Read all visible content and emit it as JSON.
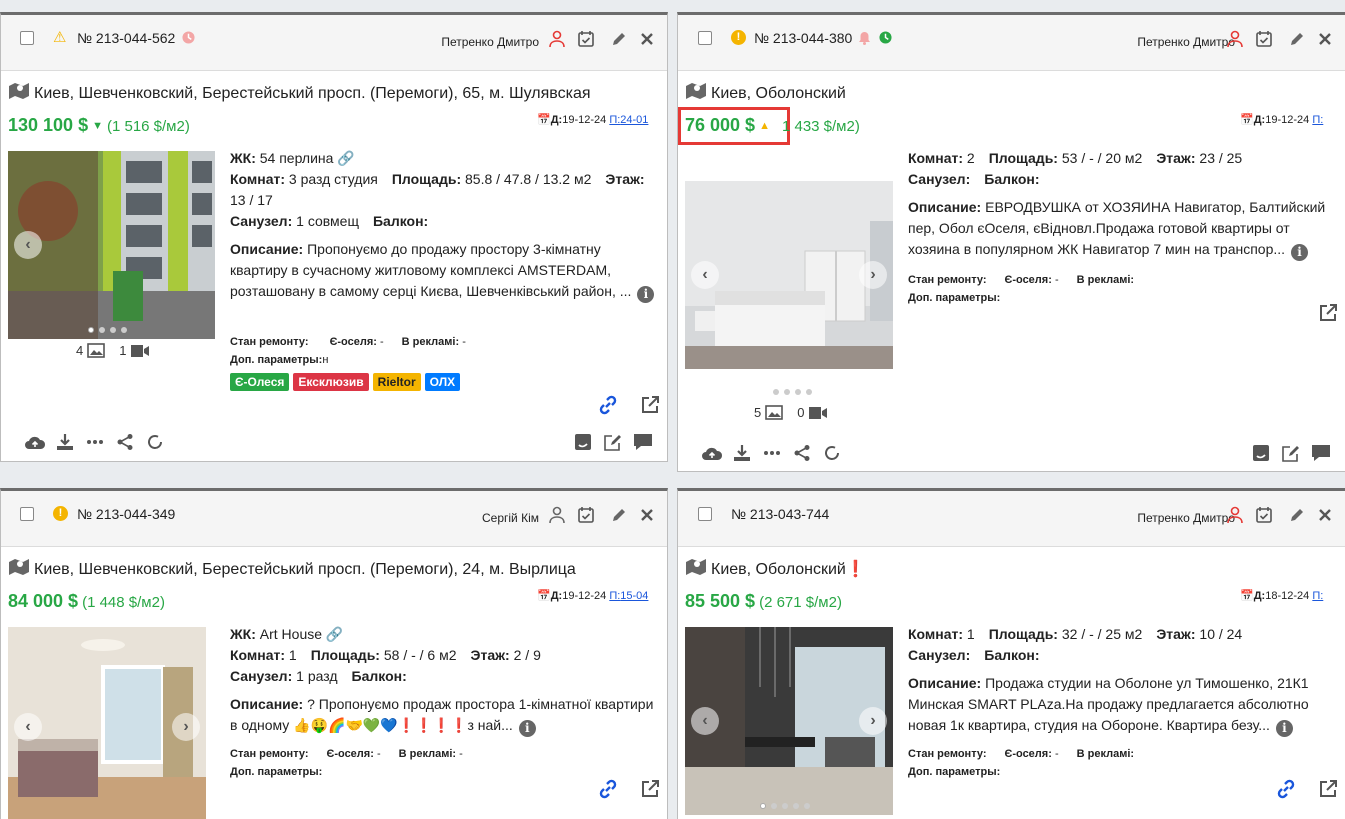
{
  "cards": [
    {
      "id": "№ 213-044-562",
      "agent": "Петренко Дмитро",
      "address": "Киев, Шевченковский, Берестейський просп. (Перемоги), 65, м. Шулявская",
      "price": "130 100 $",
      "price_per_sqm": "(1 516 $/м2)",
      "date_label": "Д:",
      "date": "19-12-24",
      "p_label": "П:",
      "p_value": "24-01",
      "zhk_label": "ЖК:",
      "zhk": "54 перлина",
      "rooms_label": "Комнат:",
      "rooms": "3 разд студия",
      "area_label": "Площадь:",
      "area": "85.8 / 47.8 / 13.2 м2",
      "floor_label": "Этаж:",
      "floor": "13 / 17",
      "bath_label": "Санузел:",
      "bath": "1 совмещ",
      "balcony_label": "Балкон:",
      "balcony": "",
      "desc_label": "Описание:",
      "desc": "Пропонуємо до продажу простору 3-кімнатну квартиру в сучасному житловому комплексі AMSTERDAM, розташовану в самому серці Києва, Шевченківський район, ...",
      "repair_label": "Стан ремонту:",
      "repair": "",
      "eoselya_label": "Є-оселя:",
      "eoselya": "-",
      "ads_label": "В рекламі:",
      "ads": "-",
      "extra_label": "Доп. параметры:",
      "extra": "н",
      "photos": "4",
      "videos": "1",
      "tags": [
        "Є-Олеся",
        "Ексклюзив",
        "Rieltor",
        "ОЛХ"
      ]
    },
    {
      "id": "№ 213-044-380",
      "agent": "Петренко Дмитро",
      "address": "Киев, Оболонский",
      "price": "76 000 $",
      "price_per_sqm": "1 433 $/м2)",
      "date_label": "Д:",
      "date": "19-12-24",
      "p_label": "П:",
      "rooms_label": "Комнат:",
      "rooms": "2",
      "area_label": "Площадь:",
      "area": "53 / - / 20 м2",
      "floor_label": "Этаж:",
      "floor": "23 / 25",
      "bath_label": "Санузел:",
      "balcony_label": "Балкон:",
      "desc_label": "Описание:",
      "desc": "ЕВРОДВУШКА от ХОЗЯИНА Навигатор, Балтийский пер, Обол єОселя, єВідновл.Продажа готовой квартиры от хозяина в популярном ЖК Навигатор 7 мин на транспор...",
      "repair_label": "Стан ремонту:",
      "eoselya_label": "Є-оселя:",
      "eoselya": "-",
      "ads_label": "В рекламі:",
      "extra_label": "Доп. параметры:",
      "photos": "5",
      "videos": "0"
    },
    {
      "id": "№ 213-044-349",
      "agent": "Сергій Кім",
      "address": "Киев, Шевченковский, Берестейський просп. (Перемоги), 24, м. Вырлица",
      "price": "84 000 $",
      "price_per_sqm": "(1 448 $/м2)",
      "date_label": "Д:",
      "date": "19-12-24",
      "p_label": "П:",
      "p_value": "15-04",
      "zhk_label": "ЖК:",
      "zhk": "Art House",
      "rooms_label": "Комнат:",
      "rooms": "1",
      "area_label": "Площадь:",
      "area": "58 / - / 6 м2",
      "floor_label": "Этаж:",
      "floor": "2 / 9",
      "bath_label": "Санузел:",
      "bath": "1 разд",
      "balcony_label": "Балкон:",
      "desc_label": "Описание:",
      "desc": "? Пропонуємо продаж простора 1-кімнатної квартири в одному 👍🤑🌈🤝💚💙❗❗❗❗з най...",
      "repair_label": "Стан ремонту:",
      "eoselya_label": "Є-оселя:",
      "eoselya": "-",
      "ads_label": "В рекламі:",
      "ads": "-",
      "extra_label": "Доп. параметры:"
    },
    {
      "id": "№ 213-043-744",
      "agent": "Петренко Дмитро",
      "address": "Киев, Оболонский",
      "address_mark": "❗",
      "price": "85 500 $",
      "price_per_sqm": "(2 671 $/м2)",
      "date_label": "Д:",
      "date": "18-12-24",
      "p_label": "П:",
      "rooms_label": "Комнат:",
      "rooms": "1",
      "area_label": "Площадь:",
      "area": "32 / - / 25 м2",
      "floor_label": "Этаж:",
      "floor": "10 / 24",
      "bath_label": "Санузел:",
      "balcony_label": "Балкон:",
      "desc_label": "Описание:",
      "desc": "Продажа студии на Оболоне ул Тимошенко, 21К1 Минская SMART PLAza.На продажу предлагается абсолютно новая 1к квартира, студия на Обороне. Квартира безу...",
      "repair_label": "Стан ремонту:",
      "eoselya_label": "Є-оселя:",
      "eoselya": "-",
      "ads_label": "В рекламі:",
      "extra_label": "Доп. параметры:"
    }
  ],
  "colors": {
    "price_green": "#28a745",
    "warning_yellow": "#f4b400",
    "highlight_red": "#e53935",
    "agent_red": "#e53935",
    "link_blue": "#1a56db"
  }
}
